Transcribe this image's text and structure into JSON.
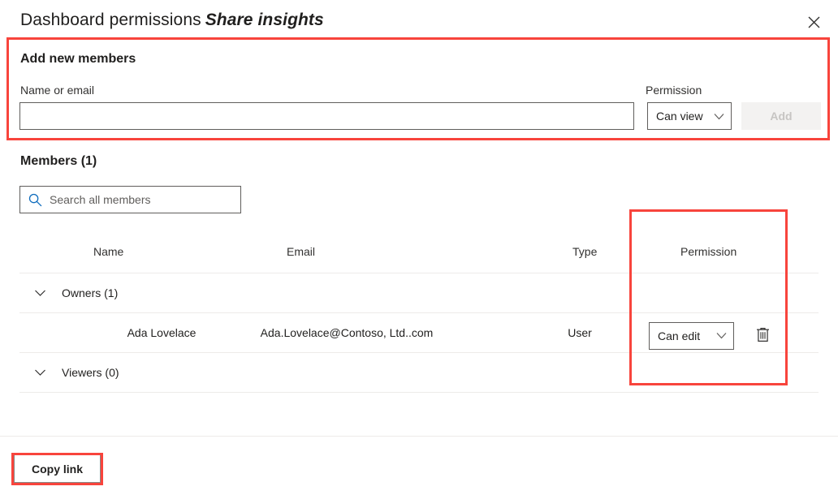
{
  "header": {
    "title_main": "Dashboard permissions",
    "title_sub": "Share insights",
    "close_icon": "close-icon"
  },
  "add_members": {
    "heading": "Add new members",
    "name_label": "Name or email",
    "name_placeholder": "",
    "name_value": "",
    "permission_label": "Permission",
    "permission_value": "Can view",
    "add_button": "Add",
    "chevron_icon": "chevron-down-icon"
  },
  "members": {
    "heading": "Members (1)",
    "search_placeholder": "Search all members",
    "search_value": "",
    "search_icon": "search-icon",
    "columns": {
      "name": "Name",
      "email": "Email",
      "type": "Type",
      "permission": "Permission"
    },
    "groups": [
      {
        "label": "Owners (1)",
        "expander_icon": "chevron-down-icon",
        "rows": [
          {
            "name": "Ada Lovelace",
            "email": "Ada.Lovelace@Contoso, Ltd..com",
            "type": "User",
            "permission": "Can edit",
            "delete_icon": "trash-icon"
          }
        ]
      },
      {
        "label": "Viewers (0)",
        "expander_icon": "chevron-down-icon",
        "rows": []
      }
    ]
  },
  "footer": {
    "copy_link": "Copy link"
  },
  "colors": {
    "annotation": "#f8443c",
    "accent": "#0078d4",
    "text": "#201f1e",
    "border": "#605e5c",
    "divider": "#edebe9",
    "disabled_bg": "#f3f2f1",
    "disabled_text": "#c7c5c3"
  }
}
